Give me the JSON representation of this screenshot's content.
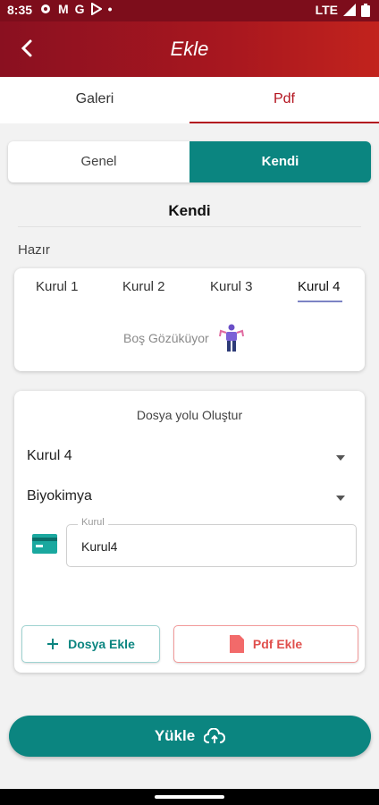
{
  "status_bar": {
    "time": "8:35",
    "icons": [
      "gear-icon",
      "gmail-icon",
      "google-icon",
      "play-store-icon",
      "dot-icon"
    ],
    "network": "LTE",
    "glyph_g": "G",
    "glyph_m": "M",
    "glyph_dot": "•"
  },
  "app_bar": {
    "title": "Ekle"
  },
  "tabs": [
    {
      "label": "Galeri"
    },
    {
      "label": "Pdf"
    }
  ],
  "segment": [
    {
      "label": "Genel"
    },
    {
      "label": "Kendi"
    }
  ],
  "section_title": "Kendi",
  "hazir_label": "Hazır",
  "kurul_tabs": [
    {
      "label": "Kurul 1"
    },
    {
      "label": "Kurul 2"
    },
    {
      "label": "Kurul 3"
    },
    {
      "label": "Kurul 4"
    }
  ],
  "empty_text": "Boş Gözüküyor",
  "path_card": {
    "title": "Dosya yolu Oluştur",
    "dropdown_kurul": "Kurul 4",
    "dropdown_ders": "Biyokimya",
    "field_label": "Kurul",
    "field_value": "Kurul4",
    "add_file_label": "Dosya Ekle",
    "add_pdf_label": "Pdf Ekle"
  },
  "upload_label": "Yükle",
  "colors": {
    "primary": "#0b8580",
    "brand": "#a8171f",
    "accent_red": "#e0504d"
  }
}
